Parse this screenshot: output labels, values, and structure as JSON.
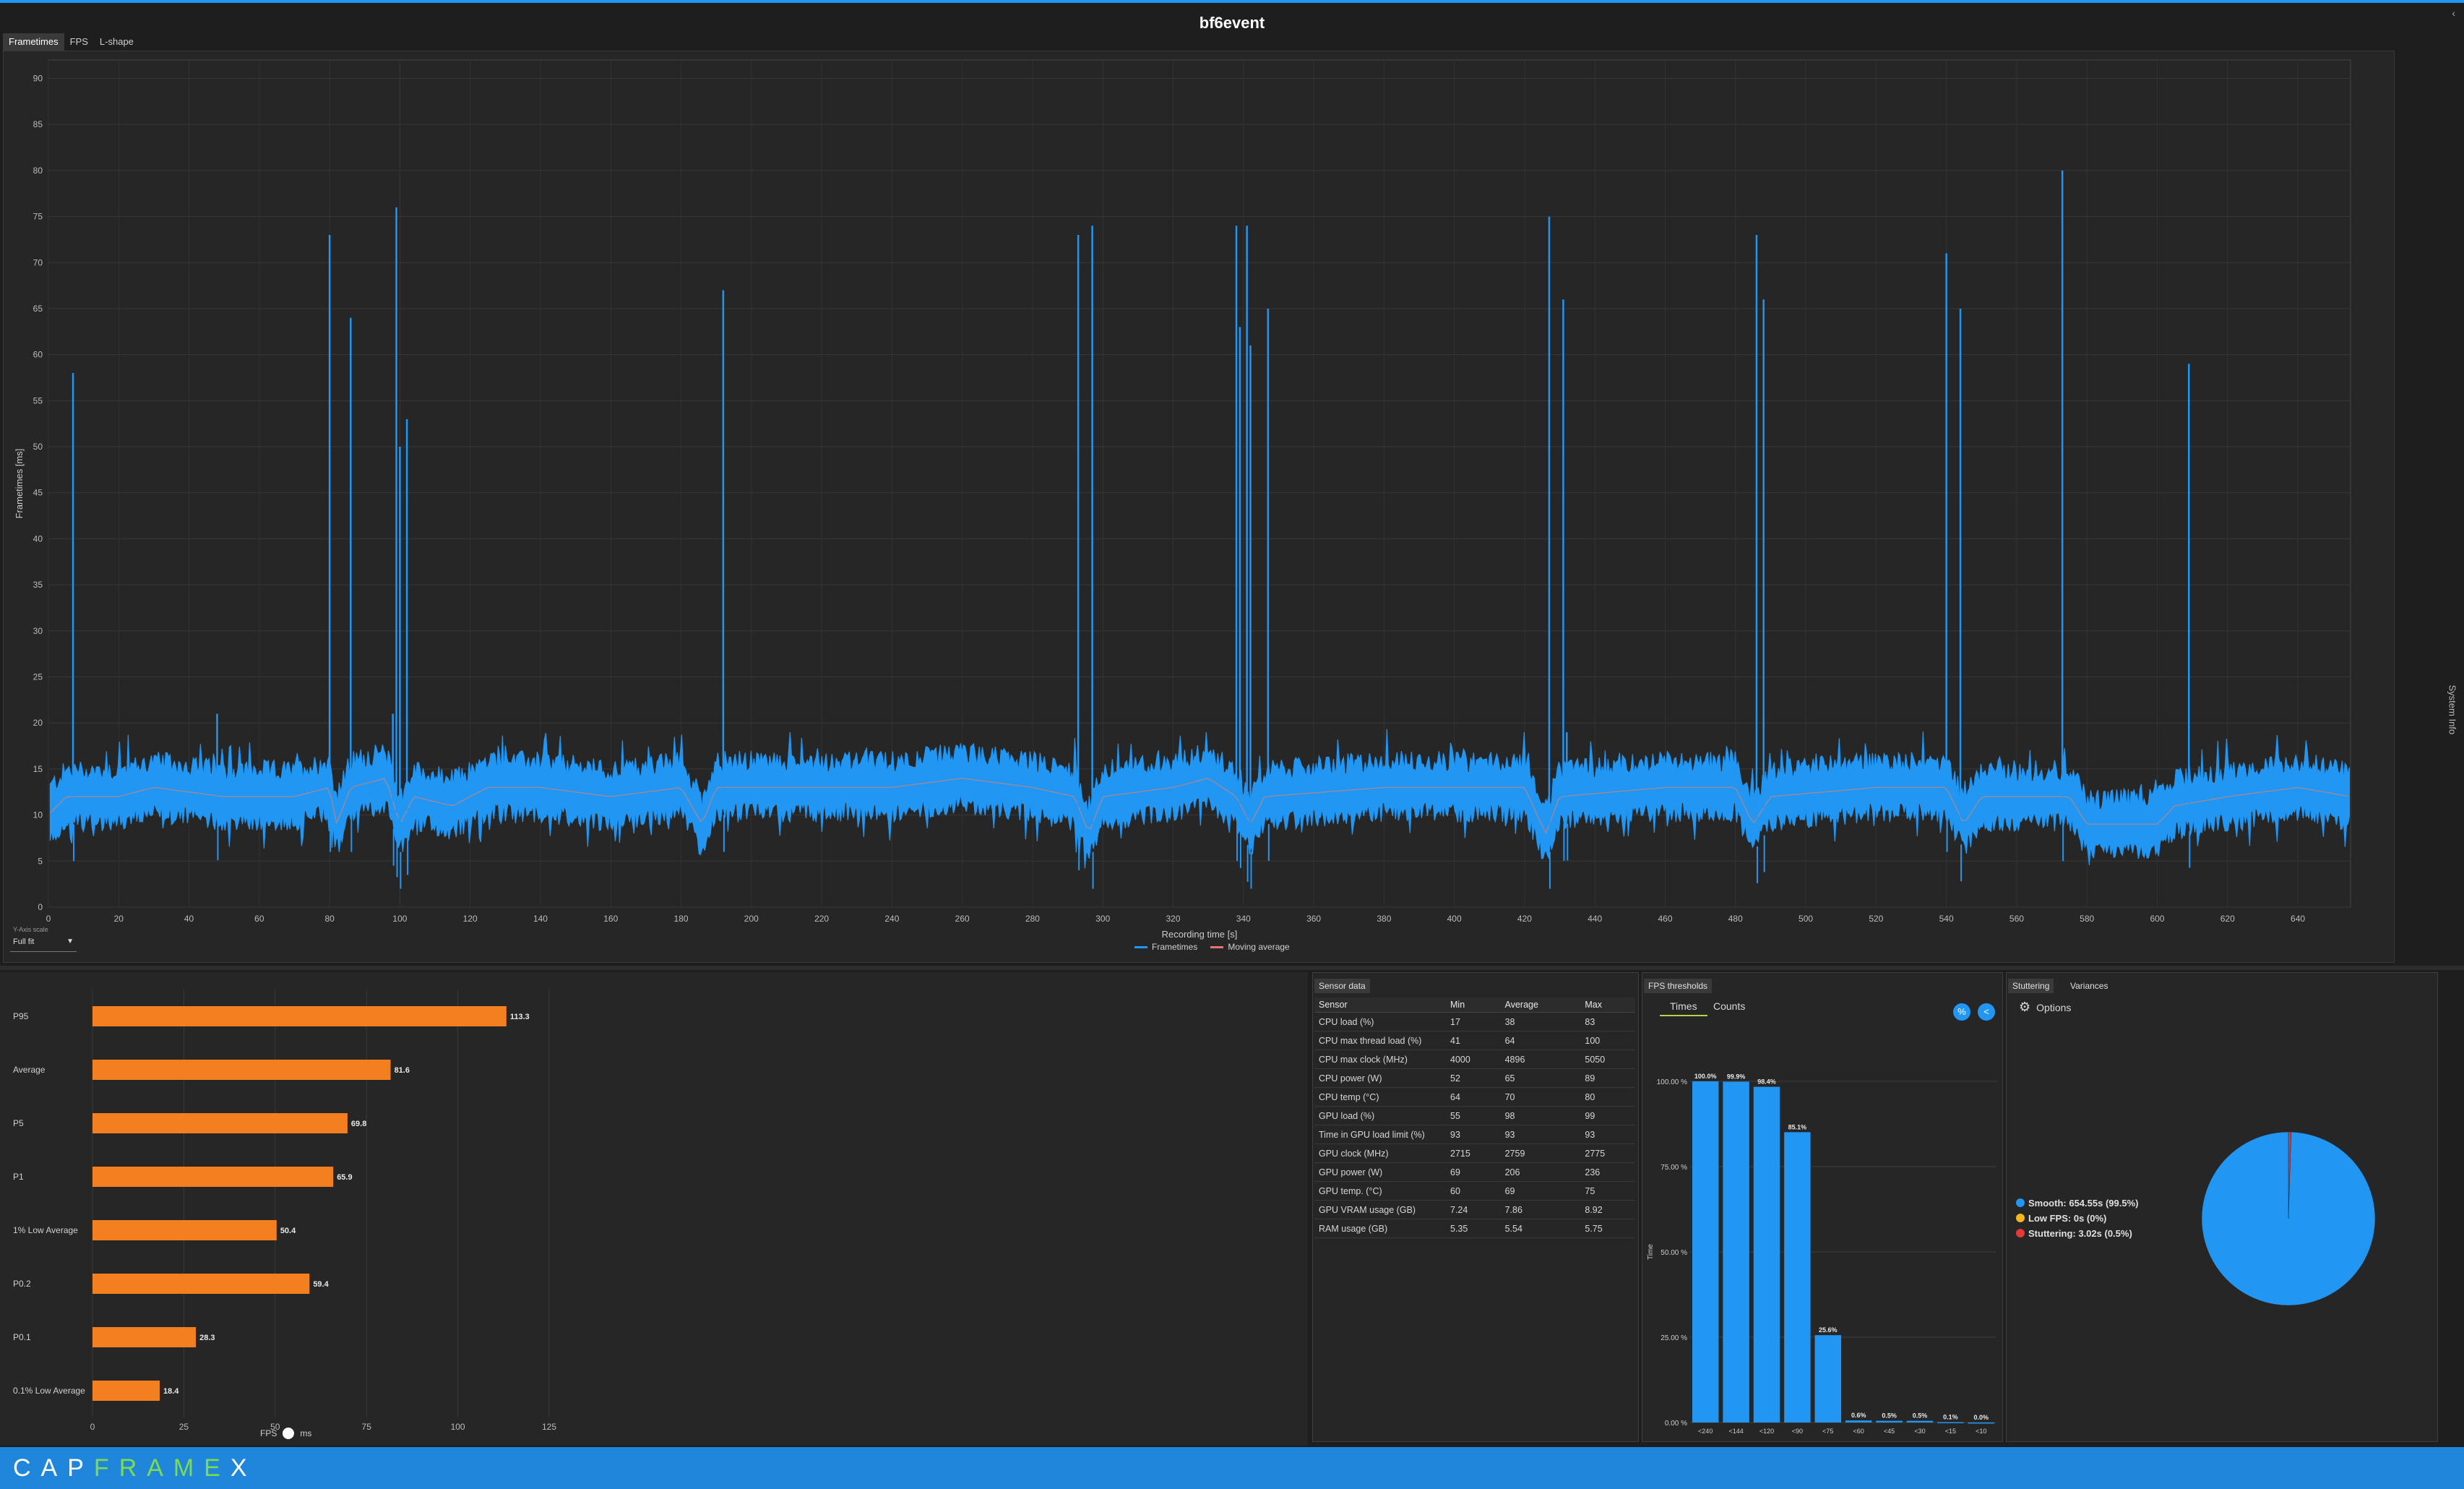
{
  "window": {
    "title": "bf6event"
  },
  "tabs": [
    "Frametimes",
    "FPS",
    "L-shape"
  ],
  "side_tab": "System Info",
  "frametime_chart": {
    "y_scale_label": "Y-Axis scale",
    "y_scale_value": "Full fit",
    "legend": [
      {
        "name": "Frametimes",
        "color": "#2196f3"
      },
      {
        "name": "Moving average",
        "color": "#e57373"
      }
    ]
  },
  "stats": {
    "toggle_left": "FPS",
    "toggle_right": "ms",
    "bar_color": "#f37f1f"
  },
  "sensor": {
    "tab": "Sensor data",
    "columns": [
      "Sensor",
      "Min",
      "Average",
      "Max"
    ],
    "rows": [
      [
        "CPU load (%)",
        "17",
        "38",
        "83"
      ],
      [
        "CPU max thread load (%)",
        "41",
        "64",
        "100"
      ],
      [
        "CPU max clock (MHz)",
        "4000",
        "4896",
        "5050"
      ],
      [
        "CPU power (W)",
        "52",
        "65",
        "89"
      ],
      [
        "CPU temp (°C)",
        "64",
        "70",
        "80"
      ],
      [
        "GPU load (%)",
        "55",
        "98",
        "99"
      ],
      [
        "Time in GPU load limit (%)",
        "93",
        "93",
        "93"
      ],
      [
        "GPU clock (MHz)",
        "2715",
        "2759",
        "2775"
      ],
      [
        "GPU power (W)",
        "69",
        "206",
        "236"
      ],
      [
        "GPU temp. (°C)",
        "60",
        "69",
        "75"
      ],
      [
        "GPU VRAM usage (GB)",
        "7.24",
        "7.86",
        "8.92"
      ],
      [
        "RAM usage (GB)",
        "5.35",
        "5.54",
        "5.75"
      ]
    ]
  },
  "thresholds": {
    "tab": "FPS thresholds",
    "subtabs": [
      "Times",
      "Counts"
    ],
    "y_title": "Time"
  },
  "stuttering": {
    "tabs": [
      "Stuttering",
      "Variances"
    ],
    "options_label": "Options",
    "legend": [
      {
        "label": "Smooth:",
        "value": "654.55s (99.5%)",
        "color": "#2196f3"
      },
      {
        "label": "Low FPS:",
        "value": "0s (0%)",
        "color": "#f5b81c"
      },
      {
        "label": "Stuttering:",
        "value": "3.02s (0.5%)",
        "color": "#e53935"
      }
    ]
  },
  "footer": {
    "brand_1": "CAP",
    "brand_2": "FRAME",
    "brand_3": "X"
  },
  "chart_data": [
    {
      "type": "line",
      "title": "",
      "xlabel": "Recording time [s]",
      "ylabel": "Frametimes [ms]",
      "xlim": [
        0,
        655
      ],
      "ylim": [
        0,
        92
      ],
      "x_ticks": [
        0,
        20,
        40,
        60,
        80,
        100,
        120,
        140,
        160,
        180,
        200,
        220,
        240,
        260,
        280,
        300,
        320,
        340,
        360,
        380,
        400,
        420,
        440,
        460,
        480,
        500,
        520,
        540,
        560,
        580,
        600,
        620,
        640
      ],
      "y_ticks": [
        0,
        5,
        10,
        15,
        20,
        25,
        30,
        35,
        40,
        45,
        50,
        55,
        60,
        65,
        70,
        75,
        80,
        85,
        90
      ],
      "grid": true,
      "legend_position": "bottom",
      "series": [
        {
          "name": "Frametimes",
          "baseline": [
            [
              0,
              10
            ],
            [
              5,
              12
            ],
            [
              20,
              12
            ],
            [
              30,
              13
            ],
            [
              50,
              12
            ],
            [
              70,
              12
            ],
            [
              80,
              13
            ],
            [
              82,
              9
            ],
            [
              86,
              13
            ],
            [
              96,
              14
            ],
            [
              100,
              9
            ],
            [
              104,
              12
            ],
            [
              115,
              11
            ],
            [
              125,
              13
            ],
            [
              140,
              13
            ],
            [
              160,
              12
            ],
            [
              180,
              13
            ],
            [
              186,
              9
            ],
            [
              190,
              13
            ],
            [
              220,
              13
            ],
            [
              240,
              13
            ],
            [
              260,
              14
            ],
            [
              280,
              13
            ],
            [
              292,
              12
            ],
            [
              296,
              8
            ],
            [
              300,
              12
            ],
            [
              320,
              13
            ],
            [
              330,
              14
            ],
            [
              338,
              12
            ],
            [
              342,
              9
            ],
            [
              346,
              12
            ],
            [
              380,
              13
            ],
            [
              400,
              13
            ],
            [
              420,
              13
            ],
            [
              426,
              8
            ],
            [
              430,
              12
            ],
            [
              460,
              13
            ],
            [
              480,
              13
            ],
            [
              485,
              9
            ],
            [
              490,
              12
            ],
            [
              520,
              13
            ],
            [
              540,
              13
            ],
            [
              545,
              9
            ],
            [
              550,
              12
            ],
            [
              575,
              12
            ],
            [
              580,
              9
            ],
            [
              600,
              9
            ],
            [
              605,
              11
            ],
            [
              620,
              12
            ],
            [
              640,
              13
            ],
            [
              655,
              12
            ]
          ],
          "spikes": [
            [
              7,
              58
            ],
            [
              80,
              73
            ],
            [
              86,
              64
            ],
            [
              99,
              76
            ],
            [
              100,
              50
            ],
            [
              102,
              53
            ],
            [
              192,
              67
            ],
            [
              293,
              73
            ],
            [
              297,
              74
            ],
            [
              338,
              74
            ],
            [
              341,
              74
            ],
            [
              339,
              63
            ],
            [
              342,
              61
            ],
            [
              347,
              65
            ],
            [
              427,
              75
            ],
            [
              431,
              66
            ],
            [
              486,
              73
            ],
            [
              488,
              66
            ],
            [
              540,
              71
            ],
            [
              544,
              65
            ],
            [
              573,
              80
            ],
            [
              609,
              59
            ],
            [
              48,
              21
            ],
            [
              98,
              21
            ],
            [
              432,
              19
            ]
          ]
        },
        {
          "name": "Moving average"
        }
      ]
    },
    {
      "type": "bar",
      "orientation": "horizontal",
      "categories": [
        "P95",
        "Average",
        "P5",
        "P1",
        "1% Low Average",
        "P0.2",
        "P0.1",
        "0.1% Low Average"
      ],
      "values": [
        113.3,
        81.6,
        69.8,
        65.9,
        50.4,
        59.4,
        28.3,
        18.4
      ],
      "xlim": [
        0,
        125
      ],
      "x_ticks": [
        0,
        25,
        50,
        75,
        100,
        125
      ],
      "grid": true
    },
    {
      "type": "bar",
      "categories": [
        "<240",
        "<144",
        "<120",
        "<90",
        "<75",
        "<60",
        "<45",
        "<30",
        "<15",
        "<10"
      ],
      "values": [
        100.0,
        99.9,
        98.4,
        85.1,
        25.6,
        0.6,
        0.5,
        0.5,
        0.1,
        0.0
      ],
      "labels": [
        "100.0%",
        "99.9%",
        "98.4%",
        "85.1%",
        "25.6%",
        "0.6%",
        "0.5%",
        "0.5%",
        "0.1%",
        "0.0%"
      ],
      "ylim": [
        0,
        100
      ],
      "y_ticks": [
        "0.00 %",
        "25.00 %",
        "50.00 %",
        "75.00 %",
        "100.00 %"
      ],
      "ylabel": "Time"
    },
    {
      "type": "pie",
      "categories": [
        "Smooth",
        "Low FPS",
        "Stuttering"
      ],
      "values": [
        99.5,
        0,
        0.5
      ],
      "colors": [
        "#2196f3",
        "#f5b81c",
        "#e53935"
      ]
    }
  ]
}
